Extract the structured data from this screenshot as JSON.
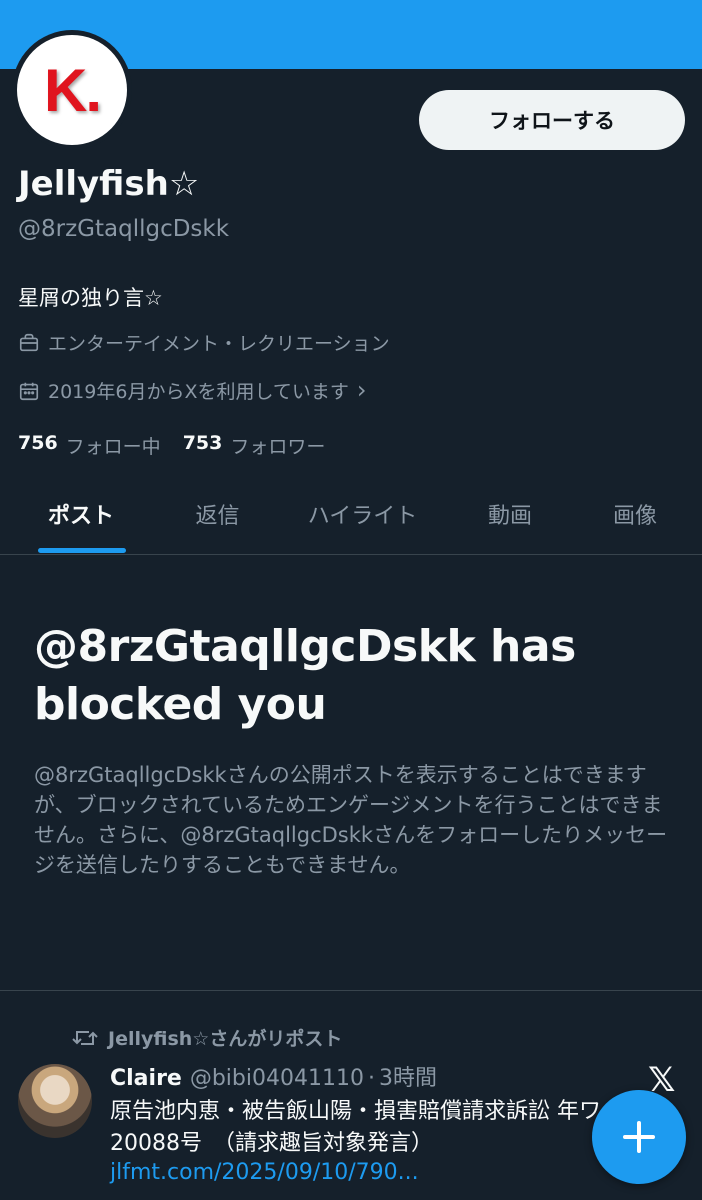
{
  "profile": {
    "avatar_letter": "K.",
    "follow_label": "フォローする",
    "name": "Jellyfish☆",
    "handle": "@8rzGtaqllgcDskk",
    "bio": "星屑の独り言☆",
    "category": "エンターテイメント・レクリエーション",
    "joined": "2019年6月からXを利用しています",
    "joined_chevron": "›",
    "following_count": "756",
    "following_label": "フォロー中",
    "followers_count": "753",
    "followers_label": "フォロワー"
  },
  "tabs": [
    {
      "label": "ポスト",
      "active": true
    },
    {
      "label": "返信",
      "active": false
    },
    {
      "label": "ハイライト",
      "active": false
    },
    {
      "label": "動画",
      "active": false
    },
    {
      "label": "画像",
      "active": false
    }
  ],
  "blocked": {
    "title": "@8rzGtaqllgcDskk has blocked you",
    "body": "@8rzGtaqllgcDskkさんの公開ポストを表示することはできますが、ブロックされているためエンゲージメントを行うことはできません。さらに、@8rzGtaqllgcDskkさんをフォローしたりメッセージを送信したりすることもできません。"
  },
  "tweet": {
    "repost_label": "Jellyfish☆さんがリポスト",
    "author": "Claire",
    "handle": "@bibi04041110",
    "separator": "·",
    "time": "3時間",
    "text": "原告池内恵・被告飯山陽・損害賠償請求訴訟 年ワ20088号　（請求趣旨対象発言）",
    "link": "jlfmt.com/2025/09/10/790..."
  },
  "colors": {
    "background": "#15202b",
    "accent": "#1d9bf0",
    "secondary_text": "#8b98a5",
    "primary_text": "#f7f9f9"
  },
  "icons": {
    "category": "briefcase-icon",
    "joined": "calendar-icon",
    "repost": "repost-icon",
    "fab": "plus-icon",
    "brand": "x-logo-icon"
  }
}
